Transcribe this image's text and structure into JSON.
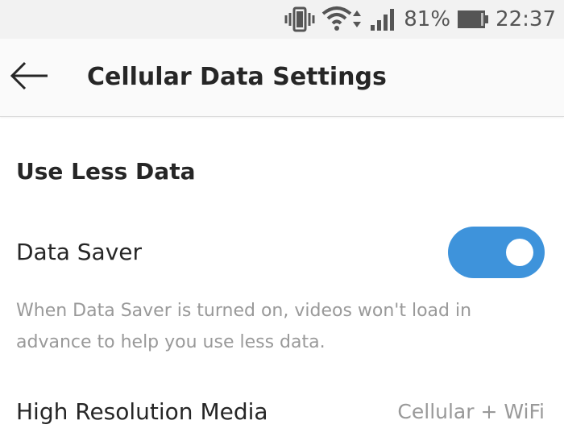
{
  "status_bar": {
    "battery_percent": "81%",
    "time": "22:37",
    "icons": [
      "vibrate-icon",
      "wifi-icon",
      "signal-icon",
      "battery-icon"
    ]
  },
  "header": {
    "title": "Cellular Data Settings",
    "back_icon": "arrow-left-icon"
  },
  "section": {
    "title": "Use Less Data"
  },
  "data_saver": {
    "label": "Data Saver",
    "enabled": true,
    "description": "When Data Saver is turned on, videos won't load in advance to help you use less data."
  },
  "high_resolution_media": {
    "label": "High Resolution Media",
    "value": "Cellular + WiFi"
  },
  "colors": {
    "accent": "#3e93db",
    "text_primary": "#262626",
    "text_secondary": "#999999",
    "status_bar_bg": "#f2f2f2"
  }
}
